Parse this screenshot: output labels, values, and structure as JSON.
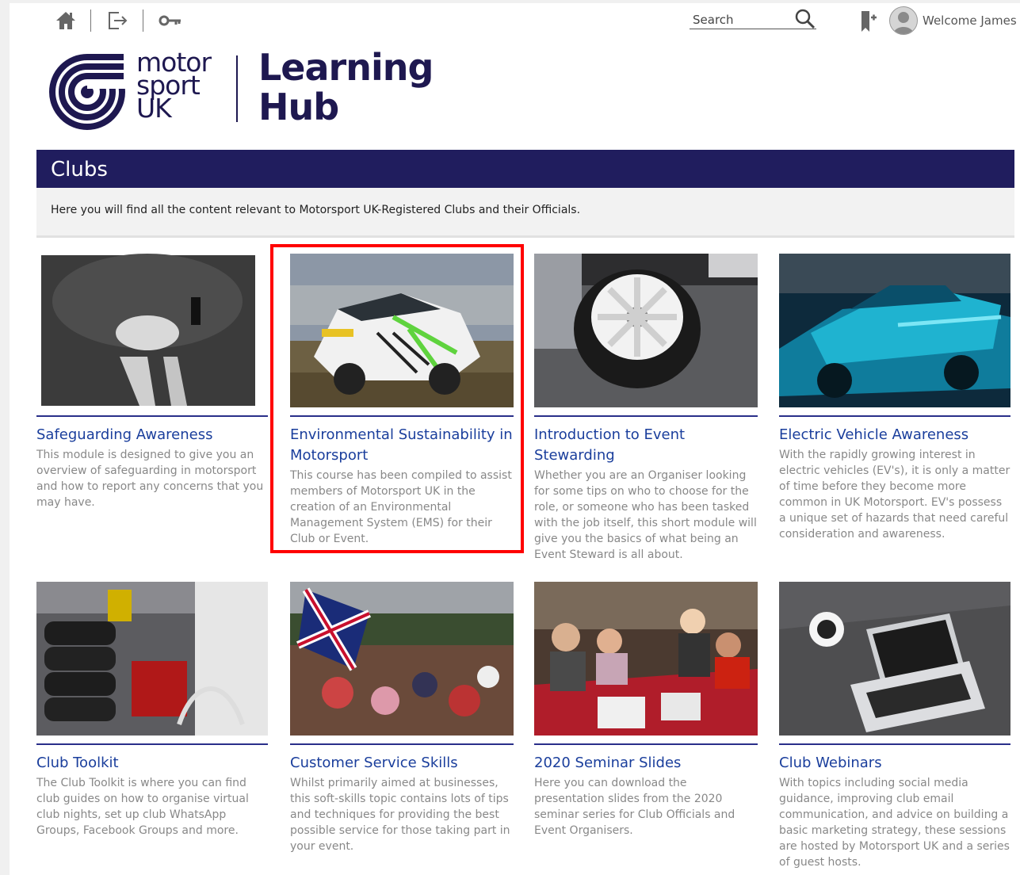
{
  "toolbar": {
    "icons": [
      "home-icon",
      "logout-icon",
      "key-icon"
    ],
    "search_label": "Search",
    "welcome": "Welcome James"
  },
  "logo": {
    "brand_lines": [
      "motor",
      "sport",
      "UK"
    ],
    "product_lines": [
      "Learning",
      "Hub"
    ],
    "color": "#1e1850"
  },
  "section": {
    "title": "Clubs",
    "description": "Here you will find all the content relevant to Motorsport UK-Registered Clubs and their Officials.",
    "bar_color": "#201d5e"
  },
  "cards": [
    {
      "title": "Safeguarding Awareness",
      "description": "This module is designed to give you an overview of safeguarding in motorsport and how to report any concerns that you may have."
    },
    {
      "title": "Environmental Sustainability in Motorsport",
      "description": "This course has been compiled to assist members of Motorsport UK in the creation of an Environmental Management System (EMS) for their Club or Event."
    },
    {
      "title": "Introduction to Event Stewarding",
      "description": "Whether you are an Organiser looking for some tips on who to choose for the role, or someone who has been tasked with the job itself, this short module will give you the basics of what being an Event Steward is all about."
    },
    {
      "title": "Electric Vehicle Awareness",
      "description": "With the rapidly growing interest in electric vehicles (EV's), it is only a matter of time before they become more common in UK Motorsport. EV's possess a unique set of hazards that need careful consideration and awareness."
    },
    {
      "title": "Club Toolkit",
      "description": "The Club Toolkit is where you can find club guides on how to organise virtual club nights, set up club WhatsApp Groups, Facebook Groups and more."
    },
    {
      "title": "Customer Service Skills",
      "description": "Whilst primarily aimed at businesses, this soft-skills topic contains lots of tips and techniques for providing the best possible service for those taking part in your event."
    },
    {
      "title": "2020 Seminar Slides",
      "description": "Here you can download the presentation slides from the 2020 seminar series for Club Officials and Event Organisers."
    },
    {
      "title": "Club Webinars",
      "description": "With topics including social media guidance, improving club email communication, and advice on building a basic marketing strategy, these sessions are hosted by Motorsport UK and a series of guest hosts."
    }
  ],
  "colors": {
    "link": "#1a3e9c",
    "highlight": "#ff0000"
  }
}
